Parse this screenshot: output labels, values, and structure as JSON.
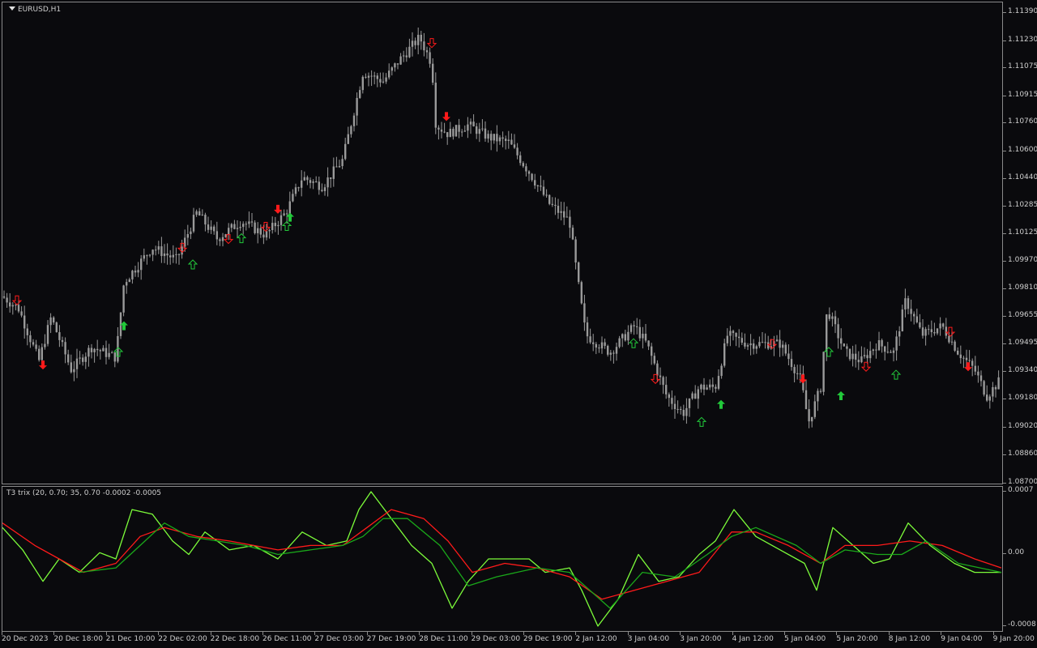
{
  "chart": {
    "symbol_label": "EURUSD,H1",
    "indicator_label": "T3 trix (20, 0.70; 35, 0.70 -0.0002 -0.0005",
    "colors": {
      "background": "#0a0a0d",
      "candle": "#9a9a9a",
      "arrow_up": "#22c83a",
      "arrow_down": "#ff1a1a",
      "trix_fast": "#7cfc3a",
      "trix_slow": "#ff1a1a",
      "trix_signal_green": "#1aa81a",
      "grid": "#8a8a8a"
    }
  },
  "price_scale": {
    "labels": [
      "1.11390",
      "1.11230",
      "1.11075",
      "1.10915",
      "1.10760",
      "1.10600",
      "1.10440",
      "1.10285",
      "1.10125",
      "1.09970",
      "1.09810",
      "1.09655",
      "1.09495",
      "1.09340",
      "1.09180",
      "1.09020",
      "1.08860",
      "1.08700"
    ]
  },
  "indicator_scale": {
    "labels": [
      "0.0007",
      "0.00",
      "-0.0008"
    ]
  },
  "time_axis": {
    "labels": [
      "20 Dec 2023",
      "20 Dec 18:00",
      "21 Dec 10:00",
      "22 Dec 02:00",
      "22 Dec 18:00",
      "26 Dec 11:00",
      "27 Dec 03:00",
      "27 Dec 19:00",
      "28 Dec 11:00",
      "29 Dec 03:00",
      "29 Dec 19:00",
      "2 Jan 12:00",
      "3 Jan 04:00",
      "3 Jan 20:00",
      "4 Jan 12:00",
      "5 Jan 04:00",
      "5 Jan 20:00",
      "8 Jan 12:00",
      "9 Jan 04:00",
      "9 Jan 20:00"
    ]
  },
  "chart_data": [
    {
      "type": "candlestick",
      "title": "EURUSD,H1",
      "ylim": [
        1.087,
        1.1145
      ],
      "close_path": [
        [
          0,
          1.0977
        ],
        [
          20,
          1.097
        ],
        [
          45,
          1.094
        ],
        [
          60,
          1.0965
        ],
        [
          85,
          1.0935
        ],
        [
          110,
          1.0948
        ],
        [
          140,
          1.0942
        ],
        [
          150,
          1.0985
        ],
        [
          185,
          1.1005
        ],
        [
          215,
          1.0998
        ],
        [
          240,
          1.1025
        ],
        [
          265,
          1.101
        ],
        [
          295,
          1.102
        ],
        [
          325,
          1.1012
        ],
        [
          350,
          1.1025
        ],
        [
          370,
          1.1045
        ],
        [
          395,
          1.104
        ],
        [
          420,
          1.1055
        ],
        [
          435,
          1.1085
        ],
        [
          445,
          1.1105
        ],
        [
          470,
          1.11
        ],
        [
          490,
          1.1112
        ],
        [
          515,
          1.1125
        ],
        [
          530,
          1.111
        ],
        [
          535,
          1.1075
        ],
        [
          550,
          1.107
        ],
        [
          575,
          1.1075
        ],
        [
          600,
          1.1068
        ],
        [
          625,
          1.1065
        ],
        [
          650,
          1.1048
        ],
        [
          675,
          1.103
        ],
        [
          700,
          1.102
        ],
        [
          712,
          1.098
        ],
        [
          720,
          1.0955
        ],
        [
          750,
          1.0945
        ],
        [
          780,
          1.096
        ],
        [
          795,
          1.095
        ],
        [
          820,
          1.092
        ],
        [
          840,
          1.091
        ],
        [
          860,
          1.0925
        ],
        [
          880,
          1.0925
        ],
        [
          895,
          1.0955
        ],
        [
          920,
          1.095
        ],
        [
          960,
          1.095
        ],
        [
          985,
          1.093
        ],
        [
          995,
          1.0905
        ],
        [
          1010,
          1.0925
        ],
        [
          1018,
          1.097
        ],
        [
          1040,
          1.0945
        ],
        [
          1060,
          1.094
        ],
        [
          1080,
          1.095
        ],
        [
          1100,
          1.0945
        ],
        [
          1115,
          1.0975
        ],
        [
          1135,
          1.0955
        ],
        [
          1160,
          1.096
        ],
        [
          1180,
          1.0945
        ],
        [
          1200,
          1.0935
        ],
        [
          1215,
          1.092
        ],
        [
          1233,
          1.093
        ]
      ],
      "arrows": [
        {
          "x": 18,
          "price": 1.0975,
          "dir": "down",
          "style": "outline"
        },
        {
          "x": 50,
          "price": 1.0938,
          "dir": "down",
          "style": "solid"
        },
        {
          "x": 143,
          "price": 1.0945,
          "dir": "up",
          "style": "outline"
        },
        {
          "x": 150,
          "price": 1.096,
          "dir": "up",
          "style": "solid"
        },
        {
          "x": 222,
          "price": 1.1005,
          "dir": "down",
          "style": "outline"
        },
        {
          "x": 235,
          "price": 1.0995,
          "dir": "up",
          "style": "outline"
        },
        {
          "x": 279,
          "price": 1.101,
          "dir": "down",
          "style": "outline"
        },
        {
          "x": 295,
          "price": 1.101,
          "dir": "up",
          "style": "outline"
        },
        {
          "x": 325,
          "price": 1.1017,
          "dir": "down",
          "style": "outline"
        },
        {
          "x": 340,
          "price": 1.1027,
          "dir": "down",
          "style": "solid"
        },
        {
          "x": 351,
          "price": 1.1017,
          "dir": "up",
          "style": "outline"
        },
        {
          "x": 355,
          "price": 1.1022,
          "dir": "up",
          "style": "solid"
        },
        {
          "x": 530,
          "price": 1.1122,
          "dir": "down",
          "style": "outline"
        },
        {
          "x": 548,
          "price": 1.108,
          "dir": "down",
          "style": "solid"
        },
        {
          "x": 779,
          "price": 1.095,
          "dir": "up",
          "style": "outline"
        },
        {
          "x": 806,
          "price": 1.093,
          "dir": "down",
          "style": "outline"
        },
        {
          "x": 863,
          "price": 1.0905,
          "dir": "up",
          "style": "outline"
        },
        {
          "x": 887,
          "price": 1.0915,
          "dir": "up",
          "style": "solid"
        },
        {
          "x": 950,
          "price": 1.095,
          "dir": "down",
          "style": "outline"
        },
        {
          "x": 988,
          "price": 1.093,
          "dir": "down",
          "style": "solid"
        },
        {
          "x": 1020,
          "price": 1.0945,
          "dir": "up",
          "style": "outline"
        },
        {
          "x": 1035,
          "price": 1.092,
          "dir": "up",
          "style": "solid"
        },
        {
          "x": 1066,
          "price": 1.0937,
          "dir": "down",
          "style": "outline"
        },
        {
          "x": 1103,
          "price": 1.0932,
          "dir": "up",
          "style": "outline"
        },
        {
          "x": 1170,
          "price": 1.0957,
          "dir": "down",
          "style": "outline"
        },
        {
          "x": 1192,
          "price": 1.0937,
          "dir": "down",
          "style": "solid"
        }
      ]
    },
    {
      "type": "line",
      "title": "T3 trix (20, 0.70; 35, 0.70 -0.0002 -0.0005",
      "ylim": [
        -0.0008,
        0.0007
      ],
      "series": [
        {
          "values": [
            [
              0,
              0.0003
            ],
            [
              25,
              5e-05
            ],
            [
              50,
              -0.0003
            ],
            [
              70,
              -5e-05
            ],
            [
              95,
              -0.0002
            ],
            [
              120,
              2e-05
            ],
            [
              140,
              -5e-05
            ],
            [
              160,
              0.0005
            ],
            [
              185,
              0.00045
            ],
            [
              210,
              0.00015
            ],
            [
              230,
              0.0
            ],
            [
              250,
              0.00025
            ],
            [
              280,
              5e-05
            ],
            [
              310,
              0.0001
            ],
            [
              340,
              -5e-05
            ],
            [
              370,
              0.00025
            ],
            [
              400,
              0.0001
            ],
            [
              425,
              0.00015
            ],
            [
              440,
              0.0005
            ],
            [
              455,
              0.0007
            ],
            [
              480,
              0.0004
            ],
            [
              505,
              0.0001
            ],
            [
              530,
              -0.0001
            ],
            [
              555,
              -0.0006
            ],
            [
              575,
              -0.0003
            ],
            [
              600,
              -5e-05
            ],
            [
              620,
              -5e-05
            ],
            [
              650,
              -5e-05
            ],
            [
              670,
              -0.0002
            ],
            [
              700,
              -0.00015
            ],
            [
              715,
              -0.0004
            ],
            [
              735,
              -0.0008
            ],
            [
              760,
              -0.0005
            ],
            [
              785,
              0.0
            ],
            [
              810,
              -0.0003
            ],
            [
              835,
              -0.00025
            ],
            [
              860,
              0.0
            ],
            [
              880,
              0.00015
            ],
            [
              903,
              0.0005
            ],
            [
              930,
              0.0002
            ],
            [
              960,
              5e-05
            ],
            [
              990,
              -0.0001
            ],
            [
              1005,
              -0.0004
            ],
            [
              1025,
              0.0003
            ],
            [
              1050,
              0.0001
            ],
            [
              1075,
              -0.0001
            ],
            [
              1095,
              -5e-05
            ],
            [
              1118,
              0.00035
            ],
            [
              1145,
              0.0001
            ],
            [
              1175,
              -0.0001
            ],
            [
              1200,
              -0.0002
            ],
            [
              1233,
              -0.0002
            ]
          ]
        },
        {
          "values": [
            [
              0,
              0.00035
            ],
            [
              40,
              0.0001
            ],
            [
              70,
              -5e-05
            ],
            [
              100,
              -0.0002
            ],
            [
              140,
              -0.0001
            ],
            [
              170,
              0.0002
            ],
            [
              200,
              0.0003
            ],
            [
              240,
              0.0002
            ],
            [
              280,
              0.00015
            ],
            [
              340,
              5e-05
            ],
            [
              380,
              0.0001
            ],
            [
              420,
              0.0001
            ],
            [
              450,
              0.0003
            ],
            [
              480,
              0.0005
            ],
            [
              520,
              0.0004
            ],
            [
              550,
              0.00015
            ],
            [
              580,
              -0.0002
            ],
            [
              620,
              -0.0001
            ],
            [
              660,
              -0.00015
            ],
            [
              700,
              -0.00025
            ],
            [
              740,
              -0.0005
            ],
            [
              780,
              -0.0004
            ],
            [
              820,
              -0.0003
            ],
            [
              860,
              -0.0002
            ],
            [
              900,
              0.00025
            ],
            [
              930,
              0.00025
            ],
            [
              970,
              0.0001
            ],
            [
              1010,
              -0.0001
            ],
            [
              1040,
              0.0001
            ],
            [
              1080,
              0.0001
            ],
            [
              1120,
              0.00015
            ],
            [
              1160,
              0.0001
            ],
            [
              1200,
              -5e-05
            ],
            [
              1233,
              -0.00015
            ]
          ]
        },
        {
          "values": [
            [
              95,
              -0.0002
            ],
            [
              140,
              -0.00015
            ],
            [
              170,
              0.0001
            ],
            [
              200,
              0.00035
            ],
            [
              230,
              0.0002
            ],
            [
              300,
              0.0001
            ],
            [
              340,
              0.0
            ],
            [
              380,
              5e-05
            ],
            [
              420,
              0.0001
            ],
            [
              445,
              0.0002
            ],
            [
              470,
              0.0004
            ],
            [
              500,
              0.0004
            ],
            [
              540,
              0.0001
            ],
            [
              575,
              -0.00035
            ],
            [
              610,
              -0.00025
            ],
            [
              660,
              -0.00015
            ],
            [
              700,
              -0.0002
            ],
            [
              750,
              -0.0006
            ],
            [
              790,
              -0.0002
            ],
            [
              830,
              -0.00025
            ],
            [
              870,
              0.0
            ],
            [
              900,
              0.0002
            ],
            [
              930,
              0.0003
            ],
            [
              980,
              0.0001
            ],
            [
              1010,
              -0.0001
            ],
            [
              1040,
              5e-05
            ],
            [
              1080,
              0.0
            ],
            [
              1110,
              0.0
            ],
            [
              1140,
              0.00015
            ],
            [
              1180,
              -0.0001
            ],
            [
              1233,
              -0.0002
            ]
          ]
        }
      ]
    }
  ]
}
